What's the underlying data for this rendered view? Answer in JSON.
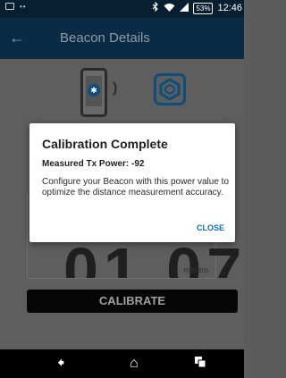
{
  "status_bar": {
    "notification_dots": "••",
    "bluetooth_icon": "bluetooth-icon",
    "wifi_icon": "wifi-icon",
    "signal_icon": "signal-icon",
    "battery": "53%",
    "time": "12:46"
  },
  "app_bar": {
    "back_icon": "arrow-left-icon",
    "title": "Beacon Details"
  },
  "content": {
    "distance_value": "01.07",
    "distance_unit": "meters",
    "calibrate_label": "CALIBRATE"
  },
  "dialog": {
    "title": "Calibration Complete",
    "subtitle": "Measured Tx Power: -92",
    "body": "Configure your Beacon with this power value to optimize the distance measurement accuracy.",
    "close_label": "CLOSE"
  },
  "nav_bar": {
    "back_icon": "back-arrow-icon",
    "home_icon": "home-icon",
    "recents_icon": "recents-icon"
  },
  "colors": {
    "app_bar": "#0a2b45",
    "accent": "#0b6fb0",
    "status_bar": "#071f30"
  }
}
